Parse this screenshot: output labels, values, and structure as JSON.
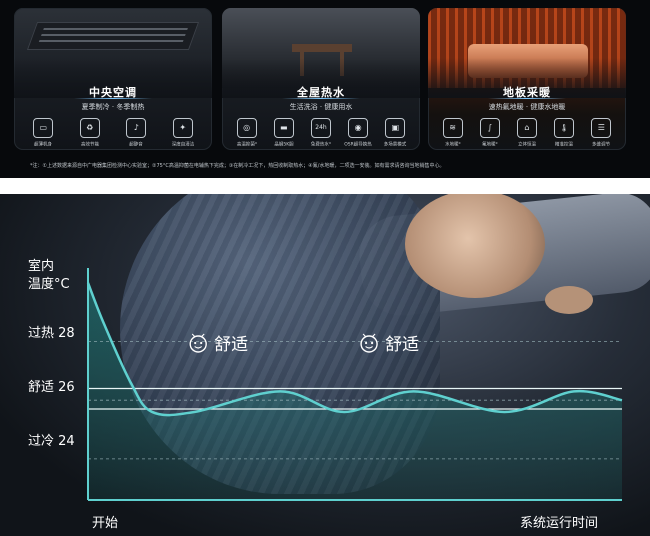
{
  "banner": {
    "cards": [
      {
        "title": "中央空调",
        "subtitle": "夏季制冷 · 冬季制热",
        "features": [
          {
            "icon": "ac-unit-icon",
            "glyph": "▭",
            "label": "超薄机身"
          },
          {
            "icon": "leaf-eco-icon",
            "glyph": "♻",
            "label": "高效节能"
          },
          {
            "icon": "quiet-dba-icon",
            "glyph": "♪",
            "label": "超静音"
          },
          {
            "icon": "clean-sparkle-icon",
            "glyph": "✦",
            "label": "深度自清洁"
          }
        ]
      },
      {
        "title": "全屋热水",
        "subtitle": "生活洗浴 · 健康用水",
        "features": [
          {
            "icon": "antibacterial-icon",
            "glyph": "◎",
            "label": "高温抑菌*"
          },
          {
            "icon": "tank-icon",
            "glyph": "▬",
            "label": "晶钢5K胆"
          },
          {
            "icon": "24h-icon",
            "glyph": "24h",
            "label": "免费热水*"
          },
          {
            "icon": "coil-icon",
            "glyph": "◉",
            "label": "OSR超导换热"
          },
          {
            "icon": "modes-icon",
            "glyph": "▣",
            "label": "多场景模式"
          }
        ]
      },
      {
        "title": "地板采暖",
        "subtitle": "速热氟地暖 · 健康水地暖",
        "features": [
          {
            "icon": "water-floor-icon",
            "glyph": "≋",
            "label": "水地暖*"
          },
          {
            "icon": "fluorine-floor-icon",
            "glyph": "∫",
            "label": "氟地暖*"
          },
          {
            "icon": "house-heat-icon",
            "glyph": "⌂",
            "label": "立体恒温"
          },
          {
            "icon": "thermometer-icon",
            "glyph": "🌡",
            "label": "精准控温"
          },
          {
            "icon": "sliders-icon",
            "glyph": "☰",
            "label": "多维调节"
          }
        ]
      }
    ],
    "footnote": "*注：①上述数据来源自中广电器集团检测中心实验室；②75°C高温抑菌在电辅热下完成；③在制冷工况下，热回收制取热水；④氟/水地暖，二项选一安装。如有需求请咨询当地销售中心。"
  },
  "chart_data": {
    "type": "line",
    "ylabel": "室内\n温度°C",
    "xlabel_start": "开始",
    "xlabel": "系统运行时间",
    "y_reference_labels": [
      "过热 28",
      "舒适 26",
      "过冷 24"
    ],
    "y_reference_values": [
      28,
      26,
      24
    ],
    "annotation": "舒适",
    "series": [
      {
        "values": [
          {
            "t": 0.0,
            "y": 30.0
          },
          {
            "t": 0.03,
            "y": 28.6
          },
          {
            "t": 0.08,
            "y": 26.6
          },
          {
            "t": 0.12,
            "y": 25.6
          },
          {
            "t": 0.2,
            "y": 25.6
          },
          {
            "t": 0.36,
            "y": 26.3
          },
          {
            "t": 0.48,
            "y": 25.6
          },
          {
            "t": 0.61,
            "y": 26.3
          },
          {
            "t": 0.78,
            "y": 25.6
          },
          {
            "t": 0.91,
            "y": 26.3
          },
          {
            "t": 1.0,
            "y": 26.0
          }
        ]
      }
    ],
    "comfort_band": [
      25.7,
      26.4
    ],
    "colors": {
      "line": "#5fd0cf",
      "band": "#e8f6f6",
      "fill": "#1f6f6e"
    }
  }
}
